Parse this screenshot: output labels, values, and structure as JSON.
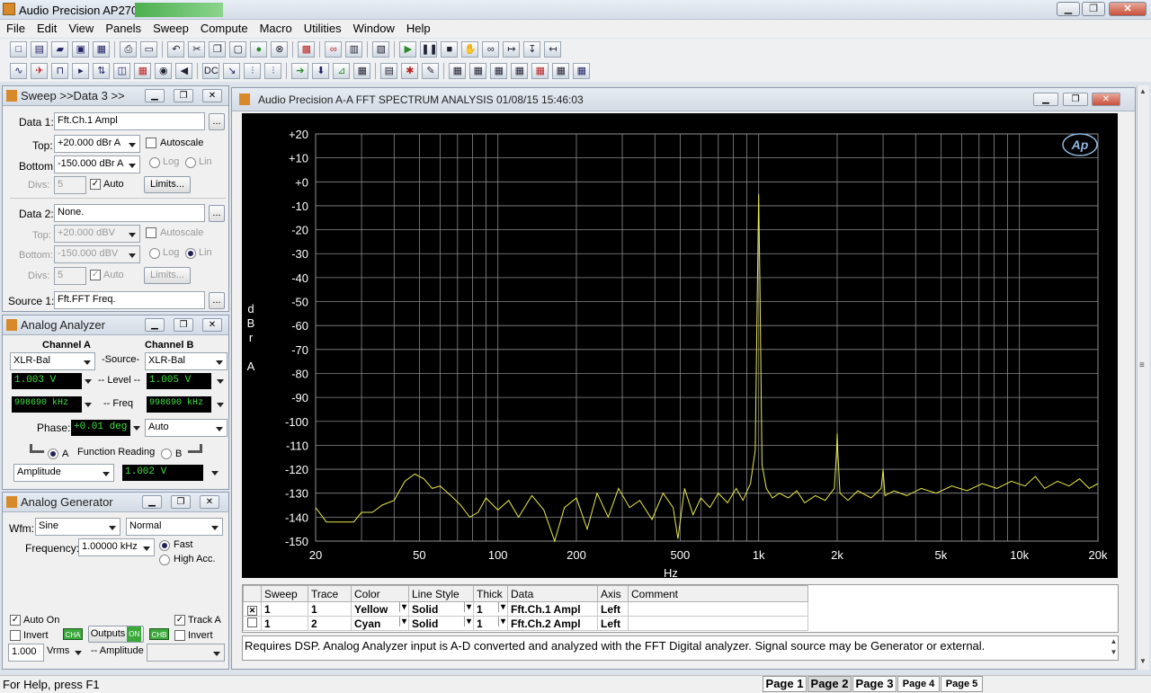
{
  "app": {
    "title": "Audio Precision AP2700 - ATHD"
  },
  "menu": [
    "File",
    "Edit",
    "View",
    "Panels",
    "Sweep",
    "Compute",
    "Macro",
    "Utilities",
    "Window",
    "Help"
  ],
  "sweep_panel": {
    "title": "Sweep >>Data 3 >>",
    "data1_label": "Data 1:",
    "data1_value": "Fft.Ch.1 Ampl",
    "top_label": "Top:",
    "top_value": "+20.000  dBr A",
    "bottom_label": "Bottom:",
    "bottom_value": "-150.000 dBr A",
    "divs_label": "Divs:",
    "divs_value": "5",
    "autoscale": "Autoscale",
    "log": "Log",
    "lin": "Lin",
    "auto": "Auto",
    "limits": "Limits...",
    "data2_label": "Data 2:",
    "data2_value": "None.",
    "top2_value": "+20.000  dBV",
    "bottom2_value": "-150.000 dBV",
    "divs2_value": "5",
    "source_label": "Source 1:",
    "source_value": "Fft.FFT Freq.",
    "browse": "..."
  },
  "analyzer_panel": {
    "title": "Analog Analyzer",
    "channel_a": "Channel A",
    "channel_b": "Channel B",
    "source_label": "-Source-",
    "source_a": "XLR-Bal",
    "source_b": "XLR-Bal",
    "level_label": "-- Level --",
    "level_a": "1.003   V",
    "level_b": "1.005   V",
    "freq_label": "-- Freq",
    "freq_a": "998690 kHz",
    "freq_b": "998690 kHz",
    "phase_label": "Phase:",
    "phase_value": "+0.01   deg",
    "phase_mode": "Auto",
    "func_label": "Function Reading",
    "func_a": "A",
    "func_b": "B",
    "func_mode": "Amplitude",
    "func_value": "1.002   V"
  },
  "generator_panel": {
    "title": "Analog Generator",
    "wfm_label": "Wfm:",
    "wfm_value": "Sine",
    "wfm_mode": "Normal",
    "freq_label": "Frequency:",
    "freq_value": "1.00000 kHz",
    "fast": "Fast",
    "high_acc": "High Acc.",
    "auto_on": "Auto On",
    "track_a": "Track A",
    "invert": "Invert",
    "cha": "CHA",
    "chb": "CHB",
    "outputs": "Outputs",
    "on": "ON",
    "amp_value": "1.000",
    "amp_unit": "Vrms",
    "amp_label": "-- Amplitude"
  },
  "graph_window": {
    "title": "Audio Precision    A-A FFT SPECTRUM ANALYSIS     01/08/15 15:46:03",
    "ap_logo": "Ap",
    "ylabel": [
      "d",
      "B",
      "r",
      "",
      "A"
    ],
    "xlabel": "Hz",
    "description": "Requires DSP.  Analog Analyzer input is A-D converted and analyzed with the FFT Digital analyzer.  Signal source may be Generator or external."
  },
  "chart_data": {
    "type": "line",
    "xscale": "log",
    "xlim": [
      20,
      20000
    ],
    "ylim": [
      -150,
      20
    ],
    "yticks": [
      20,
      10,
      0,
      -10,
      -20,
      -30,
      -40,
      -50,
      -60,
      -70,
      -80,
      -90,
      -100,
      -110,
      -120,
      -130,
      -140,
      -150
    ],
    "ytick_labels": [
      "+20",
      "+10",
      "+0",
      "-10",
      "-20",
      "-30",
      "-40",
      "-50",
      "-60",
      "-70",
      "-80",
      "-90",
      "-100",
      "-110",
      "-120",
      "-130",
      "-140",
      "-150"
    ],
    "xticks": [
      20,
      50,
      100,
      200,
      500,
      1000,
      2000,
      5000,
      10000,
      20000
    ],
    "xtick_labels": [
      "20",
      "50",
      "100",
      "200",
      "500",
      "1k",
      "2k",
      "5k",
      "10k",
      "20k"
    ],
    "grid": true,
    "series": [
      {
        "color": "#e8e84a",
        "points": [
          [
            20,
            -136
          ],
          [
            22,
            -142
          ],
          [
            25,
            -142
          ],
          [
            28,
            -142
          ],
          [
            30,
            -138
          ],
          [
            33,
            -138
          ],
          [
            36,
            -135
          ],
          [
            40,
            -133
          ],
          [
            44,
            -125
          ],
          [
            48,
            -122
          ],
          [
            52,
            -124
          ],
          [
            56,
            -128
          ],
          [
            60,
            -127
          ],
          [
            66,
            -131
          ],
          [
            72,
            -135
          ],
          [
            78,
            -140
          ],
          [
            84,
            -138
          ],
          [
            90,
            -132
          ],
          [
            100,
            -137
          ],
          [
            110,
            -133
          ],
          [
            120,
            -140
          ],
          [
            135,
            -131
          ],
          [
            150,
            -137
          ],
          [
            165,
            -150
          ],
          [
            180,
            -136
          ],
          [
            200,
            -132
          ],
          [
            220,
            -145
          ],
          [
            240,
            -130
          ],
          [
            265,
            -140
          ],
          [
            290,
            -128
          ],
          [
            320,
            -136
          ],
          [
            350,
            -133
          ],
          [
            390,
            -141
          ],
          [
            430,
            -130
          ],
          [
            470,
            -136
          ],
          [
            490,
            -149
          ],
          [
            520,
            -128
          ],
          [
            560,
            -139
          ],
          [
            600,
            -132
          ],
          [
            650,
            -136
          ],
          [
            700,
            -130
          ],
          [
            760,
            -134
          ],
          [
            820,
            -128
          ],
          [
            870,
            -133
          ],
          [
            930,
            -126
          ],
          [
            970,
            -112
          ],
          [
            990,
            -40
          ],
          [
            1000,
            -5
          ],
          [
            1010,
            -40
          ],
          [
            1030,
            -118
          ],
          [
            1070,
            -128
          ],
          [
            1130,
            -132
          ],
          [
            1200,
            -130
          ],
          [
            1300,
            -132
          ],
          [
            1400,
            -129
          ],
          [
            1500,
            -134
          ],
          [
            1650,
            -131
          ],
          [
            1800,
            -133
          ],
          [
            1950,
            -128
          ],
          [
            1990,
            -112
          ],
          [
            2000,
            -105
          ],
          [
            2010,
            -112
          ],
          [
            2050,
            -130
          ],
          [
            2200,
            -133
          ],
          [
            2400,
            -129
          ],
          [
            2700,
            -132
          ],
          [
            2950,
            -128
          ],
          [
            3000,
            -120
          ],
          [
            3050,
            -131
          ],
          [
            3300,
            -129
          ],
          [
            3700,
            -131
          ],
          [
            4200,
            -128
          ],
          [
            4800,
            -130
          ],
          [
            5500,
            -127
          ],
          [
            6300,
            -129
          ],
          [
            7200,
            -126
          ],
          [
            8200,
            -128
          ],
          [
            9300,
            -125
          ],
          [
            10500,
            -127
          ],
          [
            11500,
            -123
          ],
          [
            12500,
            -128
          ],
          [
            14000,
            -125
          ],
          [
            15500,
            -127
          ],
          [
            17000,
            -124
          ],
          [
            18500,
            -128
          ],
          [
            20000,
            -126
          ]
        ]
      }
    ]
  },
  "trace_table": {
    "headers": [
      "Sweep",
      "Trace",
      "Color",
      "Line Style",
      "Thick",
      "Data",
      "Axis",
      "Comment"
    ],
    "rows": [
      [
        "1",
        "1",
        "Yellow",
        "Solid",
        "1",
        "Fft.Ch.1 Ampl",
        "Left",
        ""
      ],
      [
        "1",
        "2",
        "Cyan",
        "Solid",
        "1",
        "Fft.Ch.2 Ampl",
        "Left",
        ""
      ]
    ]
  },
  "status": {
    "help": "For Help, press F1",
    "pages": [
      "Page 1",
      "Page 2",
      "Page 3",
      "Page 4",
      "Page 5"
    ]
  }
}
